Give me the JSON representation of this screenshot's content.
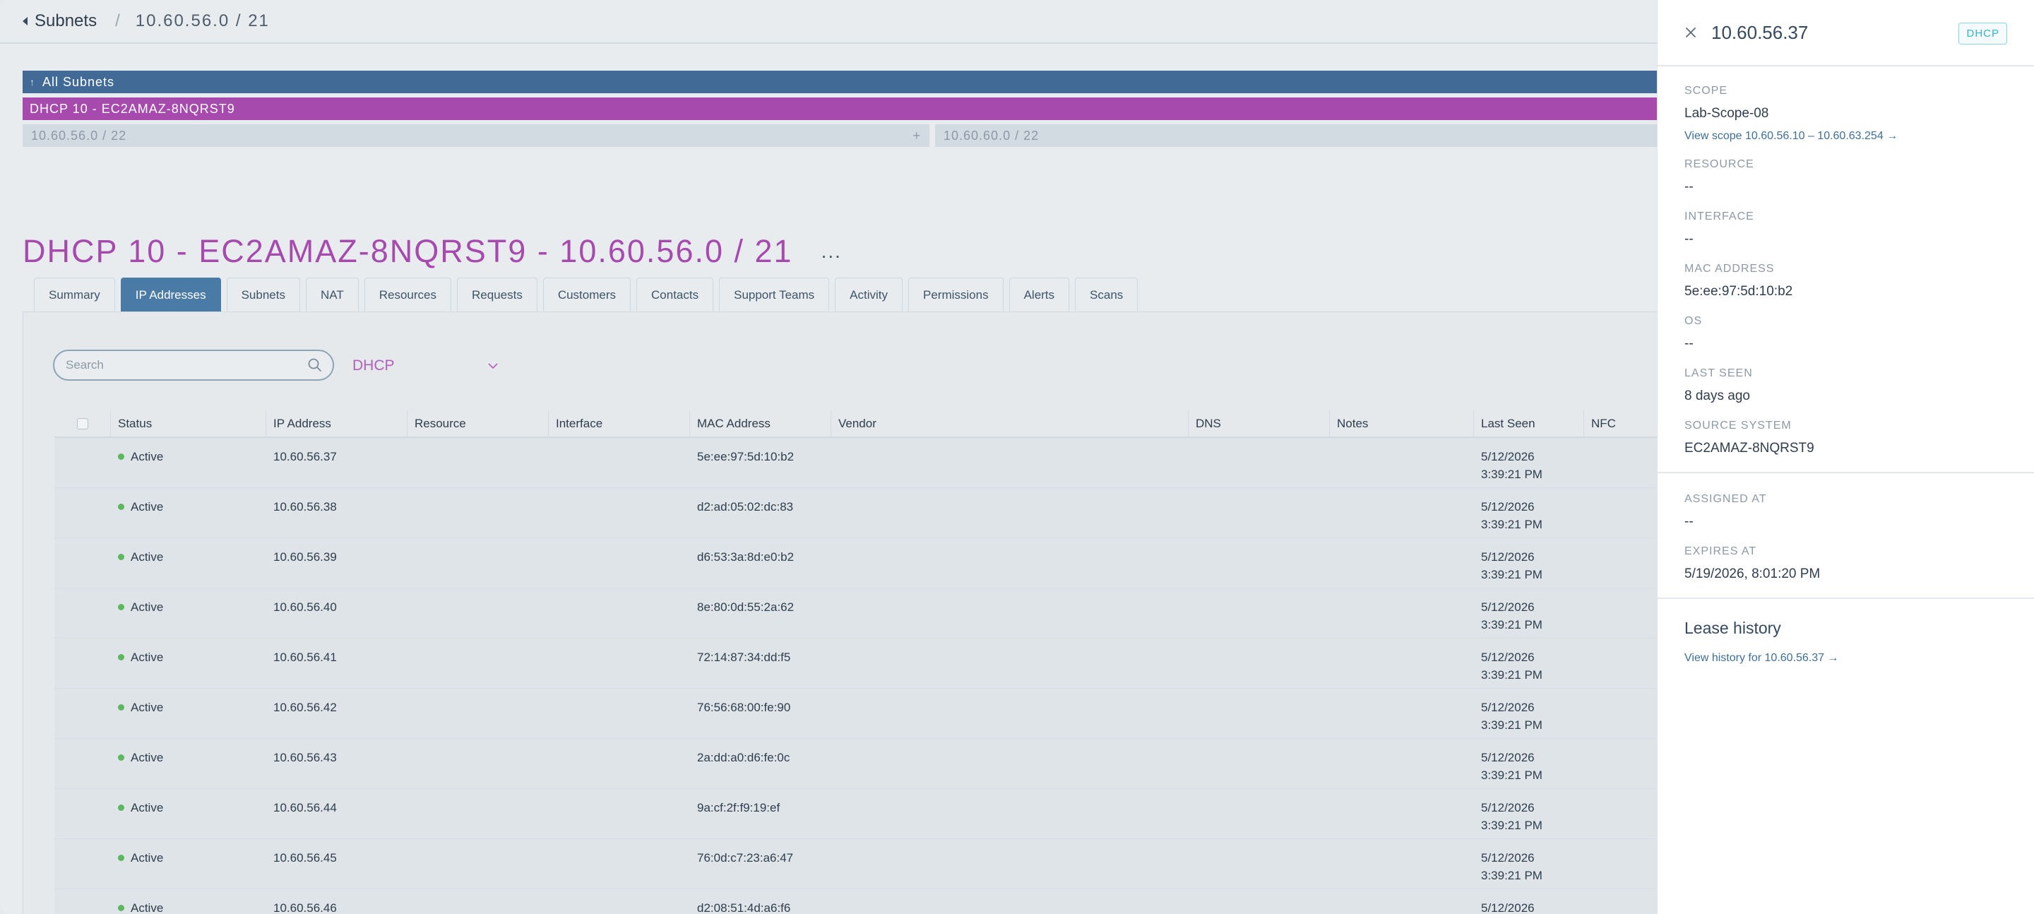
{
  "breadcrumb": {
    "back_label": "Subnets",
    "separator": "/",
    "current": "10.60.56.0 / 21"
  },
  "subnet_tree": {
    "all_label": "All Subnets",
    "up_icon": "arrow-up-icon",
    "dhcp_label": "DHCP 10 - EC2AMAZ-8NQRST9",
    "children": [
      {
        "label": "10.60.56.0 / 22",
        "action": "+"
      },
      {
        "label": "10.60.60.0 / 22",
        "action": ""
      }
    ]
  },
  "page": {
    "title": "DHCP 10 - EC2AMAZ-8NQRST9 - 10.60.56.0 / 21",
    "more_label": "...",
    "title_color": "#a64aad"
  },
  "tabs": [
    {
      "label": "Summary",
      "active": false
    },
    {
      "label": "IP Addresses",
      "active": true
    },
    {
      "label": "Subnets",
      "active": false
    },
    {
      "label": "NAT",
      "active": false
    },
    {
      "label": "Resources",
      "active": false
    },
    {
      "label": "Requests",
      "active": false
    },
    {
      "label": "Customers",
      "active": false
    },
    {
      "label": "Contacts",
      "active": false
    },
    {
      "label": "Support Teams",
      "active": false
    },
    {
      "label": "Activity",
      "active": false
    },
    {
      "label": "Permissions",
      "active": false
    },
    {
      "label": "Alerts",
      "active": false
    },
    {
      "label": "Scans",
      "active": false
    }
  ],
  "filters": {
    "search_placeholder": "Search",
    "search_value": "",
    "type_selected": "DHCP"
  },
  "table": {
    "columns": [
      "Status",
      "IP Address",
      "Resource",
      "Interface",
      "MAC Address",
      "Vendor",
      "DNS",
      "Notes",
      "Last Seen",
      "NFC"
    ],
    "rows": [
      {
        "status": "Active",
        "ip": "10.60.56.37",
        "resource": "",
        "interface": "",
        "mac": "5e:ee:97:5d:10:b2",
        "vendor": "",
        "dns": "",
        "notes": "",
        "last_seen_date": "5/12/2026",
        "last_seen_time": "3:39:21 PM",
        "nfc": ""
      },
      {
        "status": "Active",
        "ip": "10.60.56.38",
        "resource": "",
        "interface": "",
        "mac": "d2:ad:05:02:dc:83",
        "vendor": "",
        "dns": "",
        "notes": "",
        "last_seen_date": "5/12/2026",
        "last_seen_time": "3:39:21 PM",
        "nfc": ""
      },
      {
        "status": "Active",
        "ip": "10.60.56.39",
        "resource": "",
        "interface": "",
        "mac": "d6:53:3a:8d:e0:b2",
        "vendor": "",
        "dns": "",
        "notes": "",
        "last_seen_date": "5/12/2026",
        "last_seen_time": "3:39:21 PM",
        "nfc": ""
      },
      {
        "status": "Active",
        "ip": "10.60.56.40",
        "resource": "",
        "interface": "",
        "mac": "8e:80:0d:55:2a:62",
        "vendor": "",
        "dns": "",
        "notes": "",
        "last_seen_date": "5/12/2026",
        "last_seen_time": "3:39:21 PM",
        "nfc": ""
      },
      {
        "status": "Active",
        "ip": "10.60.56.41",
        "resource": "",
        "interface": "",
        "mac": "72:14:87:34:dd:f5",
        "vendor": "",
        "dns": "",
        "notes": "",
        "last_seen_date": "5/12/2026",
        "last_seen_time": "3:39:21 PM",
        "nfc": ""
      },
      {
        "status": "Active",
        "ip": "10.60.56.42",
        "resource": "",
        "interface": "",
        "mac": "76:56:68:00:fe:90",
        "vendor": "",
        "dns": "",
        "notes": "",
        "last_seen_date": "5/12/2026",
        "last_seen_time": "3:39:21 PM",
        "nfc": ""
      },
      {
        "status": "Active",
        "ip": "10.60.56.43",
        "resource": "",
        "interface": "",
        "mac": "2a:dd:a0:d6:fe:0c",
        "vendor": "",
        "dns": "",
        "notes": "",
        "last_seen_date": "5/12/2026",
        "last_seen_time": "3:39:21 PM",
        "nfc": ""
      },
      {
        "status": "Active",
        "ip": "10.60.56.44",
        "resource": "",
        "interface": "",
        "mac": "9a:cf:2f:f9:19:ef",
        "vendor": "",
        "dns": "",
        "notes": "",
        "last_seen_date": "5/12/2026",
        "last_seen_time": "3:39:21 PM",
        "nfc": ""
      },
      {
        "status": "Active",
        "ip": "10.60.56.45",
        "resource": "",
        "interface": "",
        "mac": "76:0d:c7:23:a6:47",
        "vendor": "",
        "dns": "",
        "notes": "",
        "last_seen_date": "5/12/2026",
        "last_seen_time": "3:39:21 PM",
        "nfc": ""
      },
      {
        "status": "Active",
        "ip": "10.60.56.46",
        "resource": "",
        "interface": "",
        "mac": "d2:08:51:4d:a6:f6",
        "vendor": "",
        "dns": "",
        "notes": "",
        "last_seen_date": "5/12/2026",
        "last_seen_time": "",
        "nfc": ""
      }
    ]
  },
  "detail": {
    "title": "10.60.56.37",
    "badge": "DHCP",
    "scope_label": "SCOPE",
    "scope_value": "Lab-Scope-08",
    "scope_link": "View scope 10.60.56.10 – 10.60.63.254 →",
    "resource_label": "RESOURCE",
    "resource_value": "--",
    "interface_label": "INTERFACE",
    "interface_value": "--",
    "mac_label": "MAC ADDRESS",
    "mac_value": "5e:ee:97:5d:10:b2",
    "os_label": "OS",
    "os_value": "--",
    "last_seen_label": "LAST SEEN",
    "last_seen_value": "8 days ago",
    "source_label": "SOURCE SYSTEM",
    "source_value": "EC2AMAZ-8NQRST9",
    "assigned_label": "ASSIGNED AT",
    "assigned_value": "--",
    "expires_label": "EXPIRES AT",
    "expires_value": "5/19/2026, 8:01:20 PM",
    "lease_title": "Lease history",
    "lease_link": "View history for 10.60.56.37 →"
  },
  "colors": {
    "accent_blue": "#4a7aa6",
    "tree_blue": "#416b96",
    "dhcp_purple": "#a64aad",
    "status_active": "#5cb85c",
    "badge_cyan": "#3ab0cf"
  }
}
